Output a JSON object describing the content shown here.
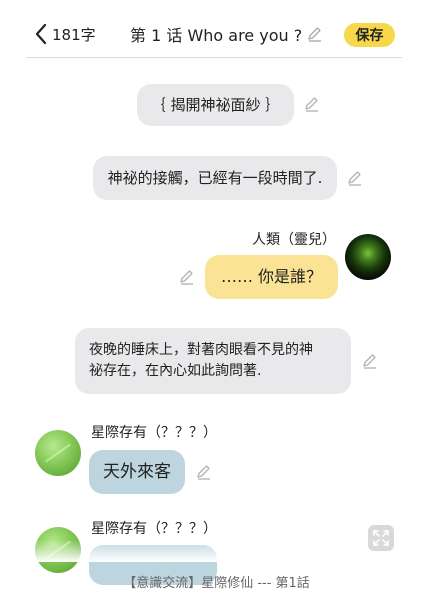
{
  "header": {
    "back_count": "181字",
    "title": "第 1 话 Who are you ?",
    "save_label": "保存"
  },
  "messages": [
    {
      "type": "narration",
      "text": "｛ 揭開神祕面紗 ｝"
    },
    {
      "type": "narration",
      "text": "神祕的接觸，已經有一段時間了."
    },
    {
      "type": "user",
      "speaker": "人類（靈兒）",
      "text": "…… 你是誰？"
    },
    {
      "type": "narration",
      "text_line1": "夜晚的睡床上，對著肉眼看不見的神",
      "text_line2": "祕存在，在內心如此詢問著."
    },
    {
      "type": "other",
      "speaker": "星際存有（？？？）",
      "text": "天外來客"
    },
    {
      "type": "other",
      "speaker": "星際存有（？？？）",
      "text": ""
    }
  ],
  "footer": {
    "caption": "【意識交流】星際修仙 --- 第1話"
  },
  "colors": {
    "accent": "#f6d84a",
    "user_bubble": "#fbe396",
    "other_bubble": "#bcd5de",
    "narration_bubble": "#e9e9eb"
  },
  "icons": [
    "chevron-left-icon",
    "pencil-icon",
    "expand-icon"
  ]
}
